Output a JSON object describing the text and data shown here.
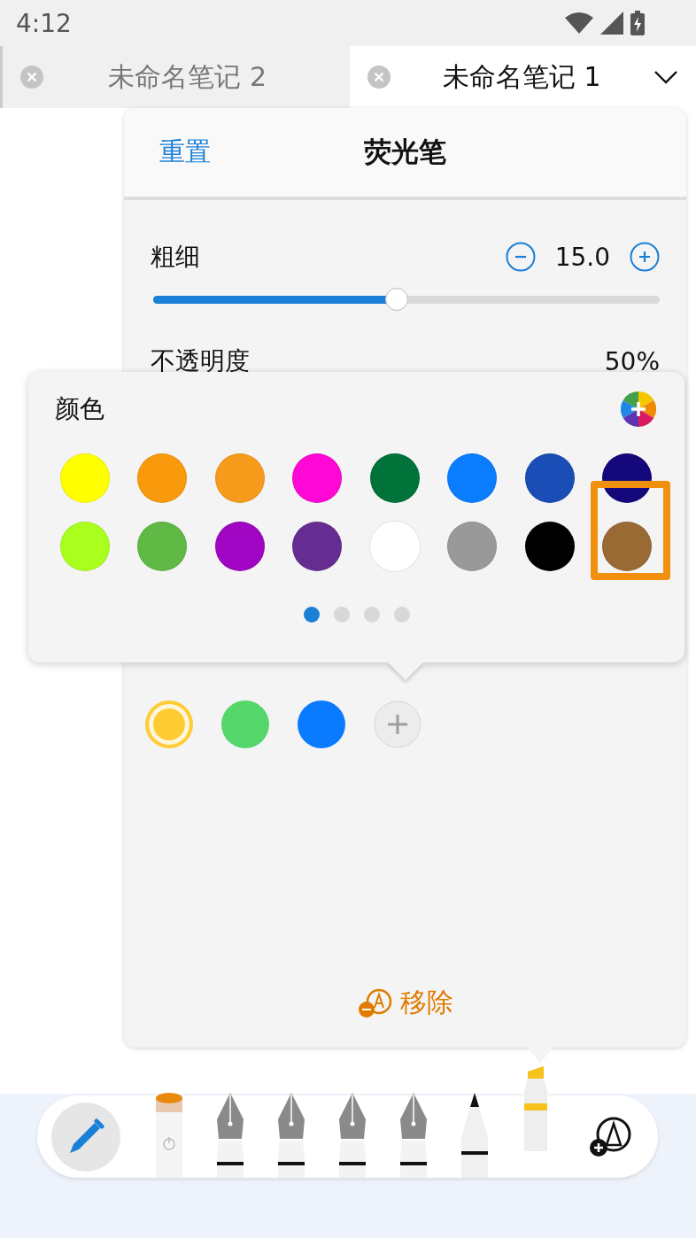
{
  "status_bar": {
    "time": "4:12"
  },
  "tabs": [
    {
      "label": "未命名笔记 2",
      "selected": false
    },
    {
      "label": "未命名笔记 1",
      "selected": true
    }
  ],
  "pen_panel": {
    "reset": "重置",
    "title": "荧光笔",
    "thickness": {
      "label": "粗细",
      "value": "15.0",
      "level": 0.48
    },
    "opacity": {
      "label": "不透明度",
      "value": "50%"
    },
    "recent_colors": [
      {
        "color": "#ffcc33",
        "selected": true
      },
      {
        "color": "#55d66b",
        "selected": false
      },
      {
        "color": "#0a7aff",
        "selected": false
      }
    ],
    "remove": "移除"
  },
  "color_popup": {
    "title": "颜色",
    "swatches": [
      {
        "color": "#ffff00",
        "highlighted": false
      },
      {
        "color": "#f99a0c",
        "highlighted": false
      },
      {
        "color": "#f79b1c",
        "highlighted": false
      },
      {
        "color": "#ff08d6",
        "highlighted": false
      },
      {
        "color": "#00733a",
        "highlighted": false
      },
      {
        "color": "#0a7dff",
        "highlighted": false
      },
      {
        "color": "#1a4db5",
        "highlighted": false
      },
      {
        "color": "#14087a",
        "highlighted": false
      },
      {
        "color": "#aaff1e",
        "highlighted": false
      },
      {
        "color": "#60b845",
        "highlighted": false
      },
      {
        "color": "#a005c4",
        "highlighted": false
      },
      {
        "color": "#652d91",
        "highlighted": false
      },
      {
        "color": "#ffffff",
        "highlighted": false
      },
      {
        "color": "#999999",
        "highlighted": false
      },
      {
        "color": "#000000",
        "highlighted": false
      },
      {
        "color": "#9a6a35",
        "highlighted": true
      }
    ],
    "pages": [
      {
        "selected": true
      },
      {
        "selected": false
      },
      {
        "selected": false
      },
      {
        "selected": false
      }
    ]
  },
  "toolbar": {
    "tools": [
      {
        "kind": "eraser",
        "selected": false
      },
      {
        "kind": "fountain",
        "selected": false
      },
      {
        "kind": "fountain",
        "selected": false
      },
      {
        "kind": "fountain",
        "selected": false
      },
      {
        "kind": "fountain",
        "selected": false
      },
      {
        "kind": "pencil",
        "selected": false
      },
      {
        "kind": "highlighter",
        "selected": true
      }
    ]
  }
}
